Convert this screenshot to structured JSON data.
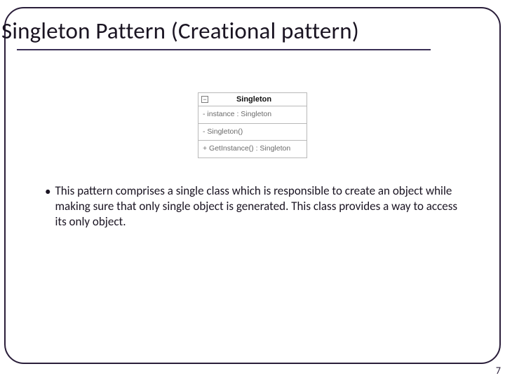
{
  "title": "Singleton Pattern (Creational pattern)",
  "uml": {
    "collapse_glyph": "−",
    "class_name": "Singleton",
    "attributes": "- instance : Singleton",
    "constructor": "- Singleton()",
    "method": "+ GetInstance() : Singleton"
  },
  "body": {
    "bullet_glyph": "•",
    "text": "This pattern comprises a single class which is responsible to create an object while making sure that only single object is generated. This class provides a way to access its only object."
  },
  "page_number": "7"
}
